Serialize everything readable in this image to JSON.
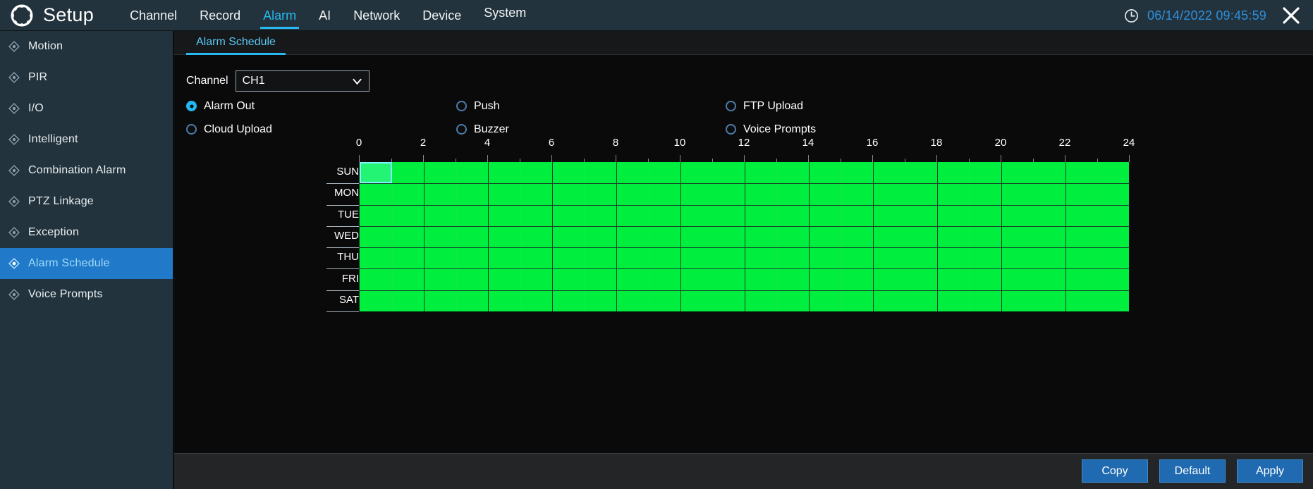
{
  "header": {
    "gear_icon": "gear-icon",
    "title": "Setup",
    "menu": [
      {
        "label": "Channel",
        "active": false
      },
      {
        "label": "Record",
        "active": false
      },
      {
        "label": "Alarm",
        "active": true
      },
      {
        "label": "AI",
        "active": false
      },
      {
        "label": "Network",
        "active": false
      },
      {
        "label": "Device",
        "active": false
      },
      {
        "label": "System",
        "active": false
      }
    ],
    "clock_icon": "clock-icon",
    "datetime": "06/14/2022 09:45:59",
    "close_icon": "close-icon",
    "accent_color": "#29b8ef",
    "datetime_color": "#2f8fdc",
    "background_color": "#22333d"
  },
  "sidebar": {
    "items": [
      {
        "label": "Motion",
        "active": false
      },
      {
        "label": "PIR",
        "active": false
      },
      {
        "label": "I/O",
        "active": false
      },
      {
        "label": "Intelligent",
        "active": false
      },
      {
        "label": "Combination Alarm",
        "active": false
      },
      {
        "label": "PTZ Linkage",
        "active": false
      },
      {
        "label": "Exception",
        "active": false
      },
      {
        "label": "Alarm Schedule",
        "active": true
      },
      {
        "label": "Voice Prompts",
        "active": false
      }
    ],
    "icon": "diamond-icon",
    "selected_bg_color": "#2079c9",
    "selected_text_color": "#9fdcf8"
  },
  "tabs": [
    {
      "label": "Alarm Schedule",
      "active": true
    }
  ],
  "channel": {
    "label": "Channel",
    "value": "CH1",
    "options": [
      "CH1"
    ],
    "chevron_icon": "chevron-down-icon"
  },
  "alarm_types": {
    "rows": [
      [
        {
          "label": "Alarm Out",
          "selected": true
        },
        {
          "label": "Push",
          "selected": false
        },
        {
          "label": "FTP Upload",
          "selected": false
        }
      ],
      [
        {
          "label": "Cloud Upload",
          "selected": false
        },
        {
          "label": "Buzzer",
          "selected": false
        },
        {
          "label": "Voice Prompts",
          "selected": false
        }
      ]
    ]
  },
  "chart_data": {
    "type": "heatmap",
    "title": "Alarm Schedule",
    "xlabel": "",
    "ylabel": "",
    "xlim": [
      0,
      24
    ],
    "x_tick_labels": [
      "0",
      "2",
      "4",
      "6",
      "8",
      "10",
      "12",
      "14",
      "16",
      "18",
      "20",
      "22",
      "24"
    ],
    "x_tick_values": [
      0,
      2,
      4,
      6,
      8,
      10,
      12,
      14,
      16,
      18,
      20,
      22,
      24
    ],
    "minor_tick_interval": 1,
    "categories": [
      "SUN",
      "MON",
      "TUE",
      "WED",
      "THU",
      "FRI",
      "SAT"
    ],
    "grid": true,
    "legend": "none",
    "cell_on_color": "#00ef3f",
    "cell_off_color": "#0a0a0a",
    "gridline_color": "#18412a",
    "selection": {
      "day": "SUN",
      "hour_start": 0,
      "hour_end": 1,
      "color": "#7ff4ff"
    },
    "series": [
      {
        "name": "SUN",
        "values": [
          1,
          1,
          1,
          1,
          1,
          1,
          1,
          1,
          1,
          1,
          1,
          1,
          1,
          1,
          1,
          1,
          1,
          1,
          1,
          1,
          1,
          1,
          1,
          1
        ]
      },
      {
        "name": "MON",
        "values": [
          1,
          1,
          1,
          1,
          1,
          1,
          1,
          1,
          1,
          1,
          1,
          1,
          1,
          1,
          1,
          1,
          1,
          1,
          1,
          1,
          1,
          1,
          1,
          1
        ]
      },
      {
        "name": "TUE",
        "values": [
          1,
          1,
          1,
          1,
          1,
          1,
          1,
          1,
          1,
          1,
          1,
          1,
          1,
          1,
          1,
          1,
          1,
          1,
          1,
          1,
          1,
          1,
          1,
          1
        ]
      },
      {
        "name": "WED",
        "values": [
          1,
          1,
          1,
          1,
          1,
          1,
          1,
          1,
          1,
          1,
          1,
          1,
          1,
          1,
          1,
          1,
          1,
          1,
          1,
          1,
          1,
          1,
          1,
          1
        ]
      },
      {
        "name": "THU",
        "values": [
          1,
          1,
          1,
          1,
          1,
          1,
          1,
          1,
          1,
          1,
          1,
          1,
          1,
          1,
          1,
          1,
          1,
          1,
          1,
          1,
          1,
          1,
          1,
          1
        ]
      },
      {
        "name": "FRI",
        "values": [
          1,
          1,
          1,
          1,
          1,
          1,
          1,
          1,
          1,
          1,
          1,
          1,
          1,
          1,
          1,
          1,
          1,
          1,
          1,
          1,
          1,
          1,
          1,
          1
        ]
      },
      {
        "name": "SAT",
        "values": [
          1,
          1,
          1,
          1,
          1,
          1,
          1,
          1,
          1,
          1,
          1,
          1,
          1,
          1,
          1,
          1,
          1,
          1,
          1,
          1,
          1,
          1,
          1,
          1
        ]
      }
    ]
  },
  "footer": {
    "buttons": [
      {
        "label": "Copy"
      },
      {
        "label": "Default"
      },
      {
        "label": "Apply"
      }
    ],
    "button_color": "#1f6ab0"
  }
}
